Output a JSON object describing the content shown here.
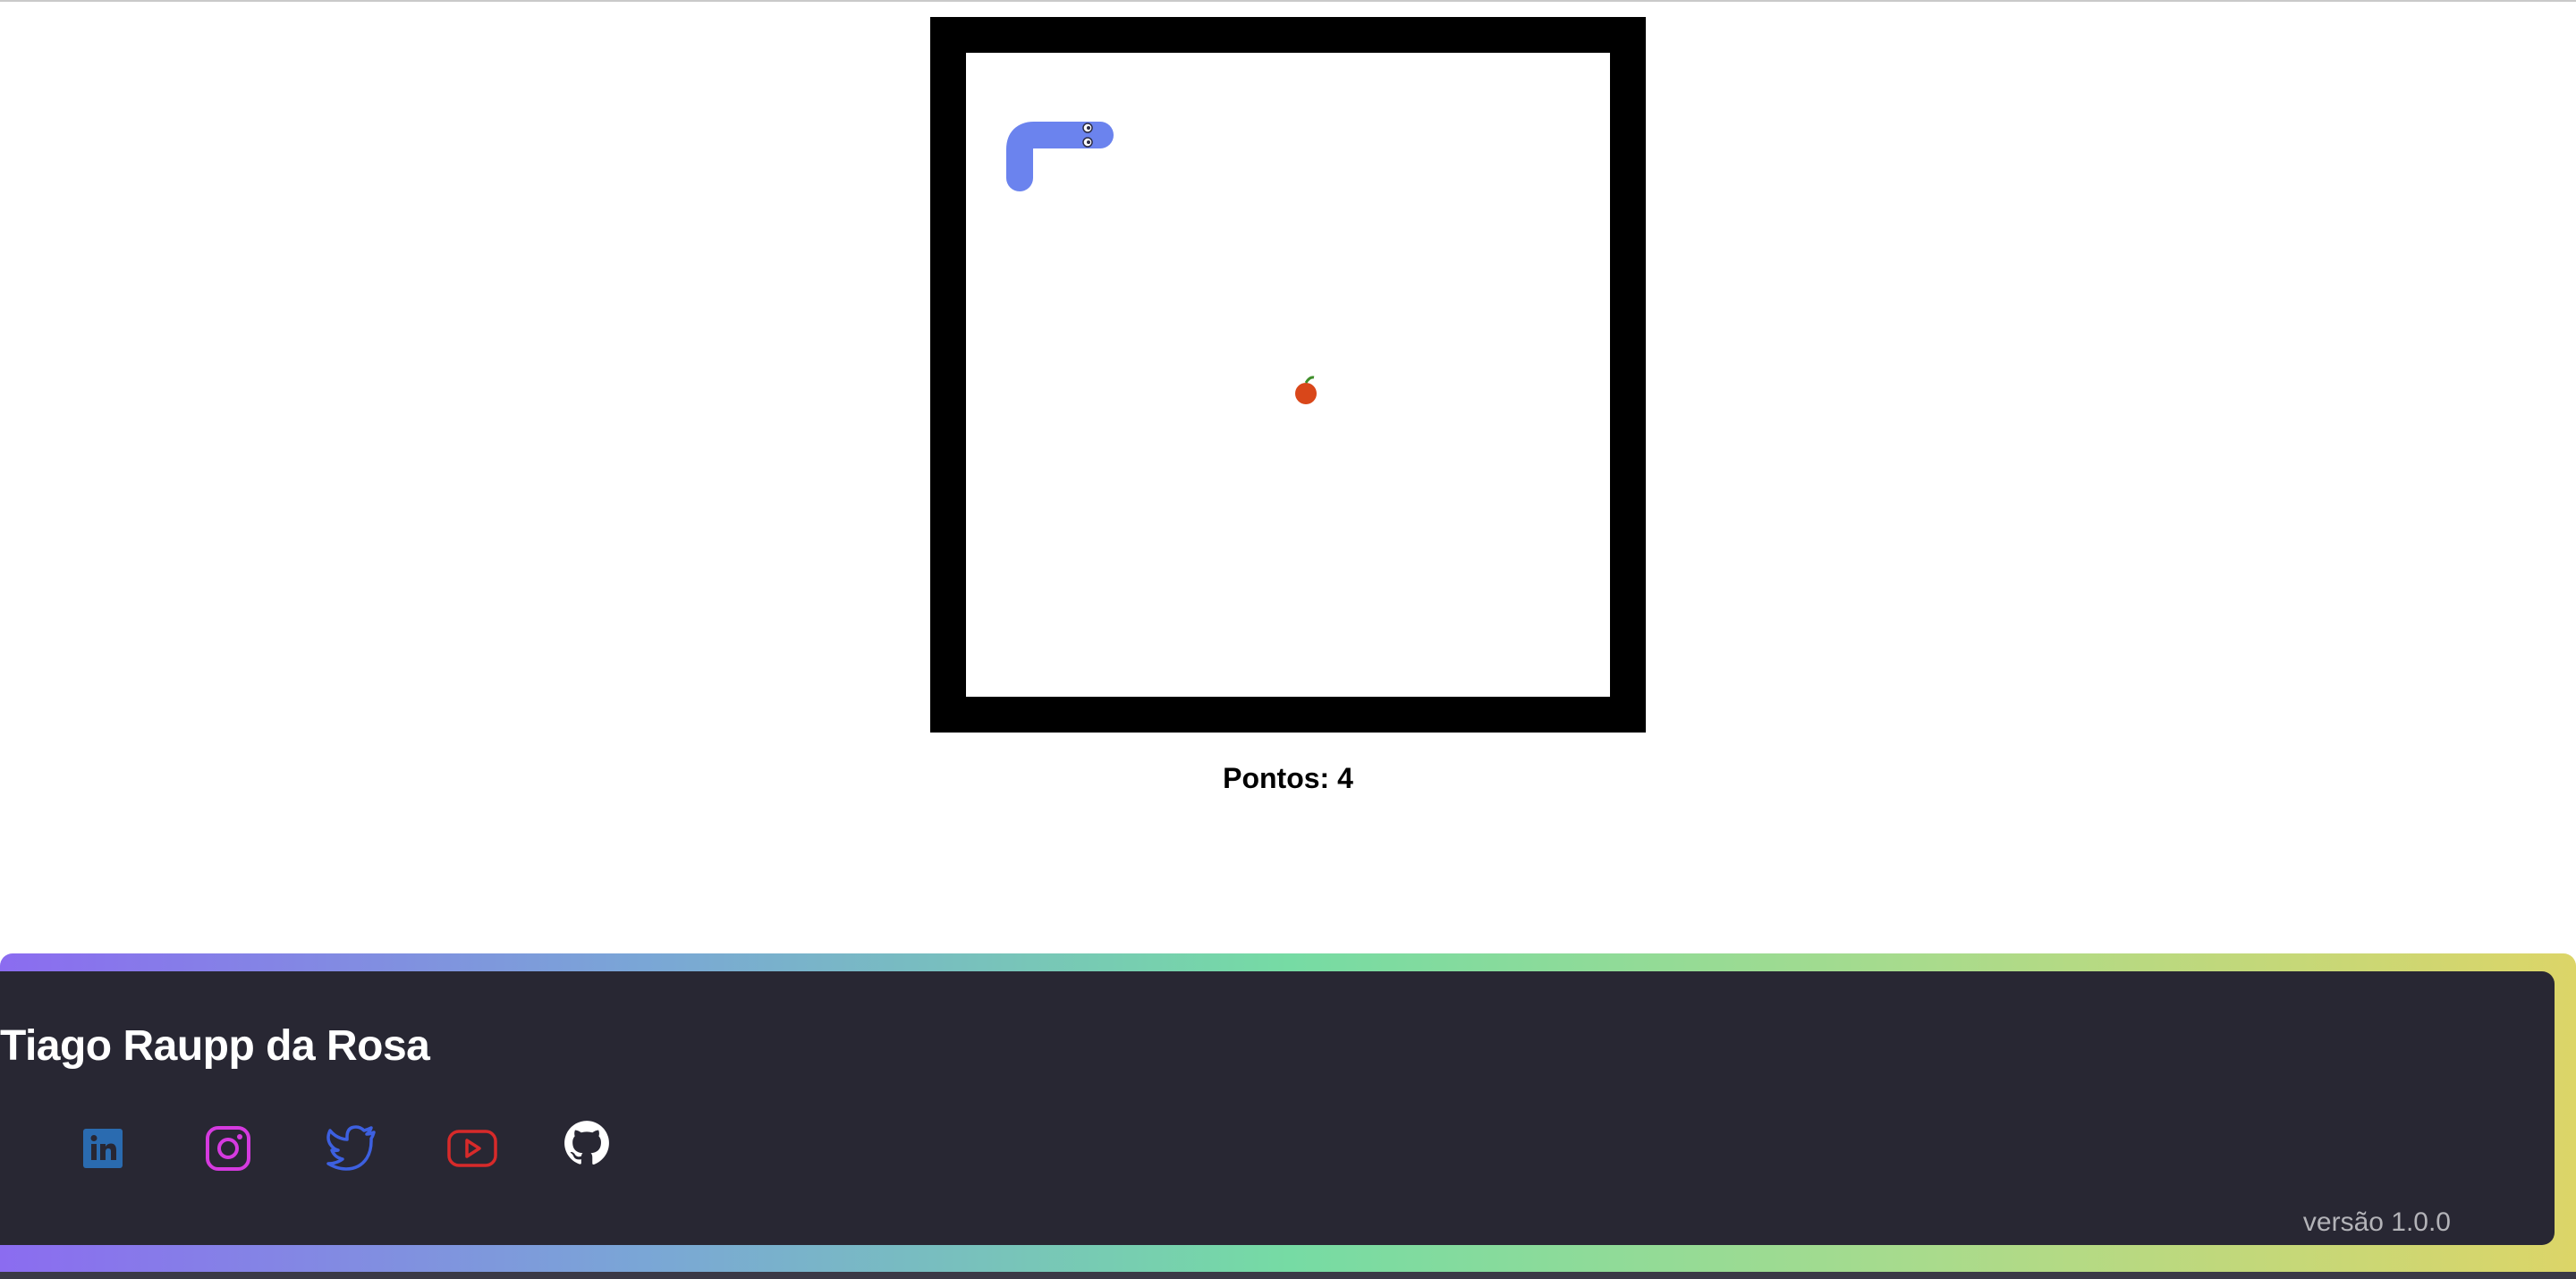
{
  "game": {
    "score_label": "Pontos:",
    "score_value": "4",
    "colors": {
      "border": "#000000",
      "board": "#ffffff",
      "snake": "#6b83ee",
      "apple": "#d9471a",
      "leaf": "#3e8e2a"
    }
  },
  "footer": {
    "author": "Tiago Raupp da Rosa",
    "version": "versão 1.0.0",
    "links": [
      {
        "icon": "linkedin-icon",
        "color": "#2a6bb0"
      },
      {
        "icon": "instagram-icon",
        "color": "#d53adf"
      },
      {
        "icon": "twitter-icon",
        "color": "#3d60e0"
      },
      {
        "icon": "youtube-icon",
        "color": "#d72a2a"
      },
      {
        "icon": "github-icon",
        "color": "#ffffff"
      }
    ]
  }
}
